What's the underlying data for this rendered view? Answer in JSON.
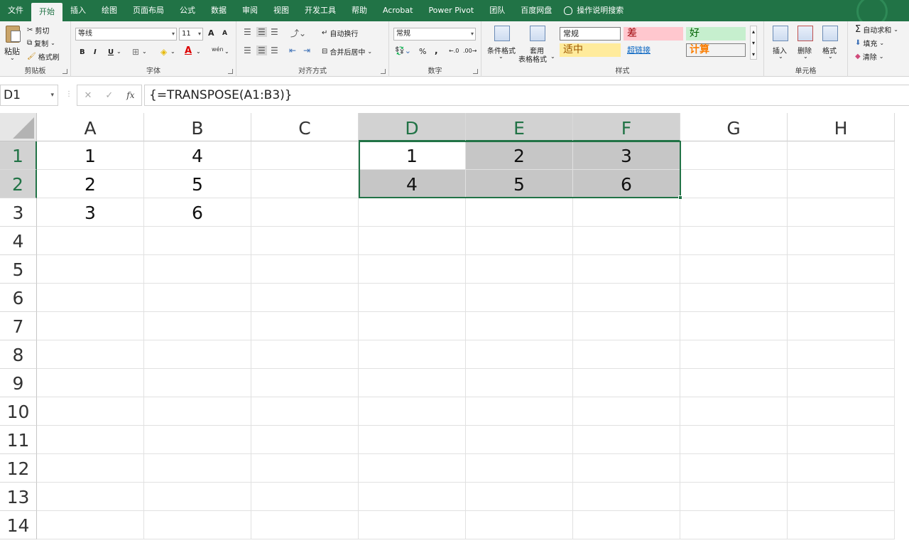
{
  "ribbon_tabs": [
    "文件",
    "开始",
    "插入",
    "绘图",
    "页面布局",
    "公式",
    "数据",
    "审阅",
    "视图",
    "开发工具",
    "帮助",
    "Acrobat",
    "Power Pivot",
    "团队",
    "百度网盘",
    "操作说明搜索"
  ],
  "active_tab": "开始",
  "clipboard": {
    "paste": "粘贴",
    "cut": "剪切",
    "copy": "复制",
    "format_painter": "格式刷",
    "label": "剪贴板"
  },
  "font": {
    "name": "等线",
    "size": "11",
    "bold": "B",
    "italic": "I",
    "underline": "U",
    "grow": "A",
    "shrink": "A",
    "wen": "wén",
    "label": "字体"
  },
  "alignment": {
    "wrap_text": "自动换行",
    "merge_center": "合并后居中",
    "label": "对齐方式"
  },
  "number": {
    "format": "常规",
    "percent": "%",
    "comma": ",",
    "label": "数字"
  },
  "styles": {
    "conditional": "条件格式",
    "table_line1": "套用",
    "table_line2": "表格格式",
    "normal": "常规",
    "bad": "差",
    "good": "好",
    "neutral": "适中",
    "hyperlink": "超链接",
    "calculation": "计算",
    "label": "样式"
  },
  "cells": {
    "insert": "插入",
    "delete": "删除",
    "format": "格式",
    "label": "单元格"
  },
  "editing": {
    "autosum": "自动求和",
    "fill": "填充",
    "clear": "清除"
  },
  "namebox": "D1",
  "formula": "{=TRANSPOSE(A1:B3)}",
  "fx_label": "fx",
  "columns": [
    "A",
    "B",
    "C",
    "D",
    "E",
    "F",
    "G",
    "H"
  ],
  "rows": [
    "1",
    "2",
    "3",
    "4",
    "5",
    "6",
    "7",
    "8",
    "9",
    "10",
    "11",
    "12",
    "13",
    "14"
  ],
  "selected_columns": [
    "D",
    "E",
    "F"
  ],
  "selected_rows": [
    "1",
    "2"
  ],
  "cell_values": [
    {
      "ref": "A1",
      "value": "1"
    },
    {
      "ref": "B1",
      "value": "4"
    },
    {
      "ref": "A2",
      "value": "2"
    },
    {
      "ref": "B2",
      "value": "5"
    },
    {
      "ref": "A3",
      "value": "3"
    },
    {
      "ref": "B3",
      "value": "6"
    },
    {
      "ref": "D1",
      "value": "1"
    },
    {
      "ref": "E1",
      "value": "2"
    },
    {
      "ref": "F1",
      "value": "3"
    },
    {
      "ref": "D2",
      "value": "4"
    },
    {
      "ref": "E2",
      "value": "5"
    },
    {
      "ref": "F2",
      "value": "6"
    }
  ],
  "colors": {
    "accent": "#217346",
    "selection": "#c6c6c6"
  }
}
